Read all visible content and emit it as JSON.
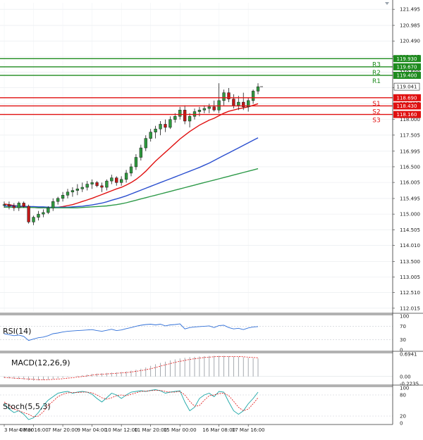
{
  "chart_data": {
    "type": "candlestick",
    "timeframe": "4H",
    "price_axis": {
      "ylim": [
        111.9,
        121.7
      ],
      "ticks": [
        "121.495",
        "120.985",
        "120.490",
        "119.995",
        "119.500",
        "119.005",
        "118.495",
        "118.000",
        "117.505",
        "116.995",
        "116.500",
        "116.005",
        "115.495",
        "115.000",
        "114.505",
        "114.010",
        "113.500",
        "113.005",
        "112.510",
        "112.015"
      ],
      "current_price": "119.041"
    },
    "x_labels": [
      "3 Mar 08:00",
      "4 Mar 16:00",
      "7 Mar 20:00",
      "9 Mar 04:00",
      "10 Mar 12:00",
      "11 Mar 20:00",
      "15 Mar 00:00",
      "16 Mar 08:00",
      "17 Mar 16:00"
    ],
    "levels": [
      {
        "name": "R3",
        "value": 119.93,
        "label": "119.930",
        "color": "#1e8b1e"
      },
      {
        "name": "R2",
        "value": 119.67,
        "label": "119.670",
        "color": "#1e8b1e"
      },
      {
        "name": "R1",
        "value": 119.4,
        "label": "119.400",
        "color": "#1e8b1e"
      },
      {
        "name": "S1",
        "value": 118.69,
        "label": "118.690",
        "color": "#e01010"
      },
      {
        "name": "S2",
        "value": 118.43,
        "label": "118.430",
        "color": "#e01010"
      },
      {
        "name": "S3",
        "value": 118.16,
        "label": "118.160",
        "color": "#e01010"
      }
    ],
    "candles": [
      [
        115.3,
        115.4,
        115.2,
        115.3
      ],
      [
        115.3,
        115.4,
        115.15,
        115.25
      ],
      [
        115.25,
        115.35,
        115.1,
        115.2
      ],
      [
        115.2,
        115.4,
        115.1,
        115.35
      ],
      [
        115.35,
        115.4,
        115.2,
        115.25
      ],
      [
        115.25,
        115.3,
        114.7,
        114.75
      ],
      [
        114.75,
        114.95,
        114.65,
        114.9
      ],
      [
        114.9,
        115.1,
        114.8,
        115.0
      ],
      [
        115.0,
        115.15,
        114.9,
        115.05
      ],
      [
        115.05,
        115.25,
        115.0,
        115.2
      ],
      [
        115.2,
        115.5,
        115.1,
        115.4
      ],
      [
        115.4,
        115.55,
        115.3,
        115.5
      ],
      [
        115.5,
        115.7,
        115.4,
        115.6
      ],
      [
        115.6,
        115.8,
        115.5,
        115.7
      ],
      [
        115.7,
        115.85,
        115.55,
        115.75
      ],
      [
        115.75,
        115.95,
        115.6,
        115.8
      ],
      [
        115.8,
        116.0,
        115.7,
        115.85
      ],
      [
        115.85,
        116.05,
        115.75,
        115.95
      ],
      [
        115.95,
        116.1,
        115.8,
        116.0
      ],
      [
        116.0,
        116.05,
        115.85,
        115.9
      ],
      [
        115.9,
        116.0,
        115.7,
        115.85
      ],
      [
        115.85,
        116.1,
        115.75,
        116.05
      ],
      [
        116.05,
        116.25,
        115.95,
        116.15
      ],
      [
        116.15,
        116.2,
        115.9,
        116.0
      ],
      [
        116.0,
        116.2,
        115.9,
        116.1
      ],
      [
        116.1,
        116.4,
        116.0,
        116.3
      ],
      [
        116.3,
        116.6,
        116.2,
        116.5
      ],
      [
        116.5,
        116.9,
        116.4,
        116.8
      ],
      [
        116.8,
        117.2,
        116.7,
        117.1
      ],
      [
        117.1,
        117.5,
        117.0,
        117.4
      ],
      [
        117.4,
        117.7,
        117.3,
        117.6
      ],
      [
        117.6,
        117.8,
        117.4,
        117.7
      ],
      [
        117.7,
        117.95,
        117.5,
        117.85
      ],
      [
        117.85,
        118.0,
        117.6,
        117.75
      ],
      [
        117.75,
        118.1,
        117.7,
        118.0
      ],
      [
        118.0,
        118.2,
        117.9,
        118.1
      ],
      [
        118.1,
        118.4,
        118.0,
        118.3
      ],
      [
        118.3,
        118.45,
        117.85,
        117.95
      ],
      [
        117.95,
        118.2,
        117.75,
        118.1
      ],
      [
        118.1,
        118.35,
        118.0,
        118.25
      ],
      [
        118.25,
        118.4,
        118.1,
        118.3
      ],
      [
        118.3,
        118.45,
        118.2,
        118.35
      ],
      [
        118.35,
        118.5,
        118.2,
        118.4
      ],
      [
        118.4,
        118.6,
        118.25,
        118.3
      ],
      [
        118.3,
        119.15,
        118.2,
        118.6
      ],
      [
        118.6,
        118.95,
        118.45,
        118.85
      ],
      [
        118.85,
        119.0,
        118.55,
        118.65
      ],
      [
        118.65,
        118.8,
        118.35,
        118.45
      ],
      [
        118.45,
        118.75,
        118.3,
        118.55
      ],
      [
        118.55,
        118.85,
        118.3,
        118.4
      ],
      [
        118.4,
        118.7,
        118.25,
        118.6
      ],
      [
        118.6,
        118.95,
        118.5,
        118.9
      ],
      [
        118.9,
        119.15,
        118.8,
        119.04
      ]
    ],
    "moving_averages": [
      {
        "color": "#e01010",
        "values": [
          115.32,
          115.3,
          115.27,
          115.25,
          115.23,
          115.22,
          115.21,
          115.2,
          115.2,
          115.2,
          115.21,
          115.22,
          115.24,
          115.27,
          115.3,
          115.35,
          115.4,
          115.45,
          115.5,
          115.56,
          115.62,
          115.68,
          115.74,
          115.8,
          115.85,
          115.92,
          116.0,
          116.1,
          116.22,
          116.36,
          116.52,
          116.68,
          116.82,
          116.96,
          117.1,
          117.24,
          117.38,
          117.5,
          117.62,
          117.72,
          117.82,
          117.9,
          117.98,
          118.04,
          118.12,
          118.2,
          118.26,
          118.3,
          118.34,
          118.37,
          118.4,
          118.45,
          118.5
        ]
      },
      {
        "color": "#2b4fcf",
        "values": [
          115.26,
          115.26,
          115.26,
          115.25,
          115.25,
          115.24,
          115.24,
          115.23,
          115.23,
          115.22,
          115.22,
          115.22,
          115.22,
          115.22,
          115.23,
          115.24,
          115.25,
          115.27,
          115.29,
          115.32,
          115.35,
          115.39,
          115.44,
          115.48,
          115.53,
          115.58,
          115.64,
          115.7,
          115.76,
          115.82,
          115.88,
          115.94,
          116.0,
          116.06,
          116.12,
          116.18,
          116.24,
          116.3,
          116.36,
          116.42,
          116.48,
          116.55,
          116.62,
          116.7,
          116.78,
          116.86,
          116.94,
          117.02,
          117.1,
          117.18,
          117.26,
          117.34,
          117.42
        ]
      },
      {
        "color": "#2e9a49",
        "values": [
          115.22,
          115.22,
          115.22,
          115.21,
          115.21,
          115.21,
          115.21,
          115.2,
          115.2,
          115.2,
          115.2,
          115.2,
          115.2,
          115.2,
          115.2,
          115.2,
          115.21,
          115.22,
          115.23,
          115.24,
          115.25,
          115.26,
          115.28,
          115.3,
          115.33,
          115.36,
          115.4,
          115.44,
          115.48,
          115.52,
          115.56,
          115.6,
          115.64,
          115.68,
          115.72,
          115.76,
          115.8,
          115.84,
          115.88,
          115.92,
          115.96,
          116.0,
          116.04,
          116.08,
          116.12,
          116.16,
          116.2,
          116.24,
          116.28,
          116.32,
          116.36,
          116.4,
          116.44
        ]
      }
    ],
    "rsi": {
      "label": "RSI(14)",
      "ylim": [
        0,
        100
      ],
      "ticks": [
        "100",
        "70",
        "30",
        "0"
      ],
      "values": [
        48,
        45,
        42,
        44,
        40,
        28,
        32,
        36,
        38,
        42,
        48,
        50,
        53,
        55,
        56,
        57,
        58,
        59,
        60,
        57,
        55,
        58,
        61,
        57,
        59,
        63,
        66,
        70,
        73,
        75,
        76,
        74,
        76,
        71,
        74,
        75,
        77,
        62,
        66,
        68,
        69,
        70,
        71,
        66,
        72,
        73,
        66,
        62,
        64,
        60,
        65,
        68,
        69
      ]
    },
    "macd": {
      "label": "MACD(12,26,9)",
      "ticks": [
        "0.6941",
        "0.00",
        "-0.2235"
      ],
      "hist": [
        -0.05,
        -0.06,
        -0.07,
        -0.08,
        -0.09,
        -0.12,
        -0.13,
        -0.12,
        -0.11,
        -0.1,
        -0.08,
        -0.06,
        -0.04,
        -0.02,
        0.0,
        0.02,
        0.04,
        0.06,
        0.08,
        0.09,
        0.1,
        0.11,
        0.12,
        0.13,
        0.14,
        0.16,
        0.18,
        0.21,
        0.24,
        0.28,
        0.33,
        0.38,
        0.42,
        0.46,
        0.5,
        0.53,
        0.56,
        0.58,
        0.6,
        0.61,
        0.62,
        0.63,
        0.64,
        0.64,
        0.64,
        0.64,
        0.63,
        0.62,
        0.61,
        0.6,
        0.58,
        0.57,
        0.56
      ],
      "signal": [
        -0.03,
        -0.04,
        -0.05,
        -0.06,
        -0.07,
        -0.08,
        -0.09,
        -0.1,
        -0.1,
        -0.1,
        -0.09,
        -0.08,
        -0.07,
        -0.05,
        -0.04,
        -0.02,
        0.0,
        0.02,
        0.04,
        0.06,
        0.07,
        0.08,
        0.09,
        0.1,
        0.11,
        0.12,
        0.14,
        0.16,
        0.18,
        0.21,
        0.24,
        0.28,
        0.32,
        0.36,
        0.4,
        0.44,
        0.47,
        0.5,
        0.53,
        0.55,
        0.57,
        0.59,
        0.6,
        0.61,
        0.62,
        0.62,
        0.62,
        0.62,
        0.62,
        0.61,
        0.6,
        0.59,
        0.58
      ]
    },
    "stoch": {
      "label": "Stoch(5,5,3)",
      "ylim": [
        0,
        100
      ],
      "ticks": [
        "100",
        "80",
        "20",
        "0"
      ],
      "k": [
        55,
        40,
        30,
        35,
        25,
        10,
        15,
        30,
        50,
        65,
        75,
        85,
        88,
        90,
        85,
        88,
        90,
        88,
        82,
        70,
        60,
        72,
        85,
        80,
        70,
        80,
        88,
        90,
        92,
        90,
        93,
        95,
        92,
        85,
        88,
        90,
        92,
        60,
        35,
        45,
        70,
        80,
        85,
        75,
        90,
        88,
        60,
        35,
        25,
        35,
        55,
        70,
        88
      ],
      "d": [
        60,
        50,
        40,
        35,
        30,
        25,
        18,
        20,
        32,
        50,
        62,
        75,
        82,
        86,
        87,
        87,
        88,
        88,
        86,
        80,
        72,
        68,
        72,
        78,
        80,
        78,
        82,
        86,
        90,
        91,
        92,
        93,
        93,
        90,
        88,
        88,
        90,
        80,
        62,
        48,
        50,
        65,
        78,
        80,
        84,
        85,
        78,
        62,
        45,
        35,
        40,
        55,
        72
      ]
    }
  }
}
